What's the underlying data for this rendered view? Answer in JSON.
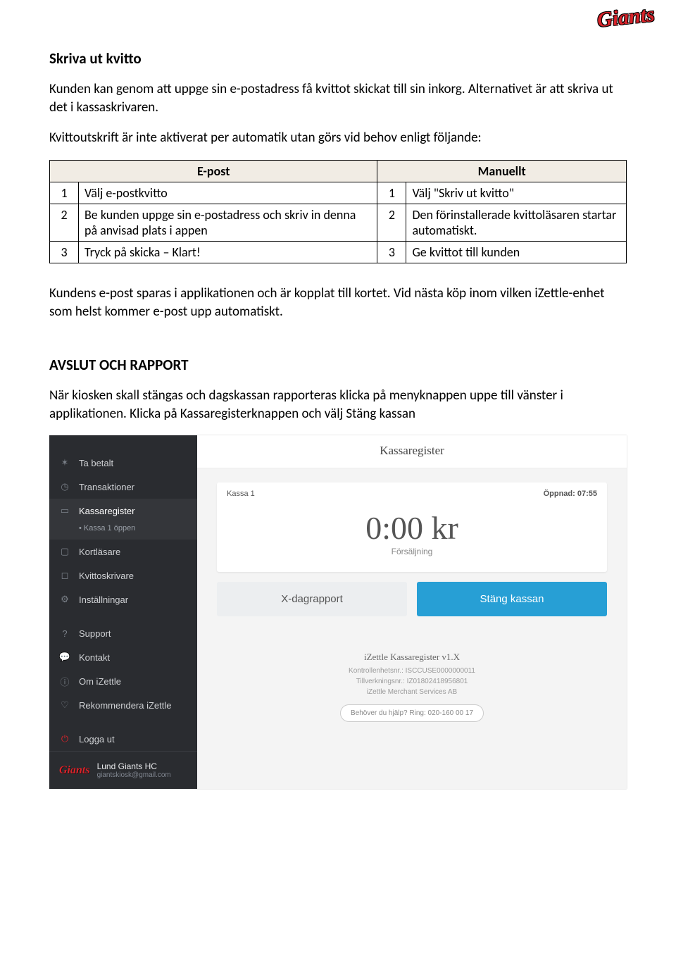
{
  "logo_text": "Giants",
  "section1": {
    "title": "Skriva ut kvitto",
    "p1": "Kunden kan genom att uppge sin e-postadress få kvittot skickat till sin inkorg. Alternativet är att skriva ut det i kassaskrivaren.",
    "p2": "Kvittoutskrift är inte aktiverat per automatik utan görs vid behov enligt följande:"
  },
  "table": {
    "head_left": "E-post",
    "head_right": "Manuellt",
    "rows": [
      {
        "ln": "1",
        "ltext": "Välj e-postkvitto",
        "rn": "1",
        "rtext": "Välj \"Skriv ut kvitto\""
      },
      {
        "ln": "2",
        "ltext": "Be kunden uppge sin e-postadress och skriv in denna på anvisad plats i appen",
        "rn": "2",
        "rtext": "Den förinstallerade kvittoläsaren startar automatiskt."
      },
      {
        "ln": "3",
        "ltext": "Tryck på skicka – Klart!",
        "rn": "3",
        "rtext": "Ge kvittot till kunden"
      }
    ]
  },
  "p_after": "Kundens e-post sparas i applikationen och är kopplat till kortet. Vid nästa köp inom vilken iZettle-enhet som helst kommer e-post upp automatiskt.",
  "section2": {
    "title": "AVSLUT OCH RAPPORT",
    "p1": "När kiosken skall stängas och dagskassan rapporteras klicka på menyknappen uppe till vänster i applikationen. Klicka på Kassaregisterknappen och välj Stäng kassan"
  },
  "shot": {
    "nav": [
      {
        "icon": "✶",
        "label": "Ta betalt"
      },
      {
        "icon": "◷",
        "label": "Transaktioner"
      },
      {
        "icon": "▭",
        "label": "Kassaregister",
        "active": true,
        "sub": "• Kassa 1 öppen"
      },
      {
        "icon": "▢",
        "label": "Kortläsare"
      },
      {
        "icon": "◻",
        "label": "Kvittoskrivare"
      },
      {
        "icon": "⚙",
        "label": "Inställningar",
        "cls": "ic-settings"
      }
    ],
    "nav2": [
      {
        "icon": "?",
        "label": "Support"
      },
      {
        "icon": "💬",
        "label": "Kontakt"
      },
      {
        "icon": "ⓘ",
        "label": "Om iZettle"
      },
      {
        "icon": "♡",
        "label": "Rekommendera iZettle"
      }
    ],
    "nav3": [
      {
        "icon": "⏻",
        "label": "Logga ut"
      }
    ],
    "footer": {
      "logo": "Giants",
      "line1": "Lund Giants HC",
      "line2": "giantskiosk@gmail.com"
    },
    "main_title": "Kassaregister",
    "card": {
      "left": "Kassa 1",
      "right": "Öppnad: 07:55",
      "amount": "0:00 kr",
      "label": "Försäljning"
    },
    "btn_left": "X-dagrapport",
    "btn_right": "Stäng kassan",
    "foot": {
      "t1": "iZettle Kassaregister v1.X",
      "l1": "Kontrollenhetsnr.: ISCCUSE0000000011",
      "l2": "Tillverkningsnr.: IZ01802418956801",
      "l3": "iZettle Merchant Services AB",
      "pill": "Behöver du hjälp? Ring: 020-160 00 17"
    }
  }
}
